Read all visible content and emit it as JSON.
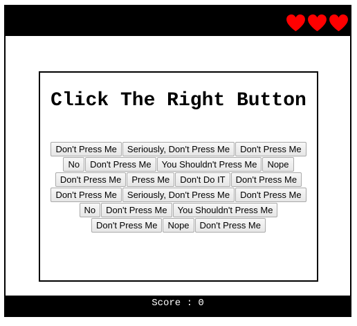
{
  "header": {
    "lives": 3,
    "heart_color": "#ff0000",
    "icon": "heart-icon"
  },
  "game": {
    "title": "Click The Right Button",
    "button_rows": [
      [
        "Don't Press Me",
        "Seriously, Don't Press Me",
        "Don't Press Me"
      ],
      [
        "No",
        "Don't Press Me",
        "You Shouldn't Press Me",
        "Nope"
      ],
      [
        "Don't Press Me",
        "Press Me",
        "Don't Do IT",
        "Don't Press Me"
      ],
      [
        "Don't Press Me",
        "Seriously, Don't Press Me",
        "Don't Press Me"
      ],
      [
        "No",
        "Don't Press Me",
        "You Shouldn't Press Me"
      ],
      [
        "Don't Press Me",
        "Nope",
        "Don't Press Me"
      ]
    ]
  },
  "footer": {
    "score_text": "Score : 0"
  }
}
